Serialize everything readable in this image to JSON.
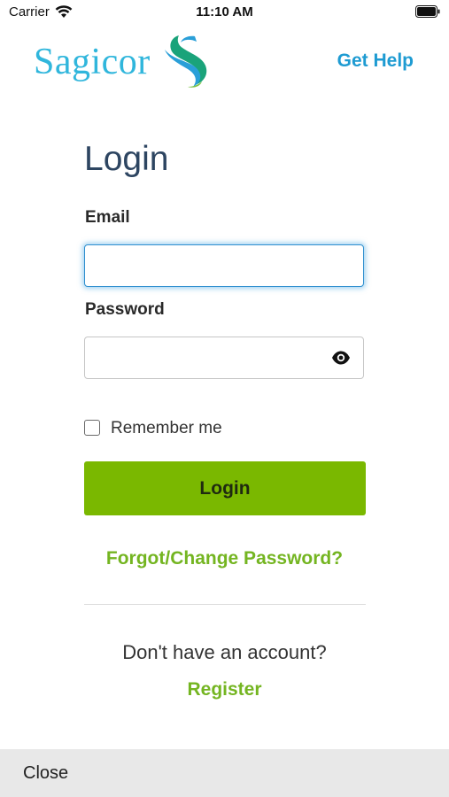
{
  "status_bar": {
    "carrier": "Carrier",
    "time": "11:10 AM"
  },
  "header": {
    "logo_text": "Sagicor",
    "get_help": "Get Help"
  },
  "form": {
    "title": "Login",
    "email_label": "Email",
    "email_value": "",
    "password_label": "Password",
    "password_value": "",
    "remember_label": "Remember me",
    "remember_checked": false,
    "login_button": "Login",
    "forgot_link": "Forgot/Change Password?"
  },
  "register_section": {
    "prompt": "Don't have an account?",
    "register_link": "Register"
  },
  "bottom_bar": {
    "close_label": "Close"
  },
  "icons": {
    "wifi": "wifi-icon",
    "battery": "battery-icon",
    "eye": "eye-icon",
    "logo_mark": "sagicor-s-logo"
  },
  "colors": {
    "brand_blue": "#30b6dc",
    "link_blue": "#1e9bd2",
    "title_navy": "#2d4561",
    "accent_green": "#7ab800",
    "link_green": "#74b521",
    "focus_blue": "#2f8fcf"
  }
}
